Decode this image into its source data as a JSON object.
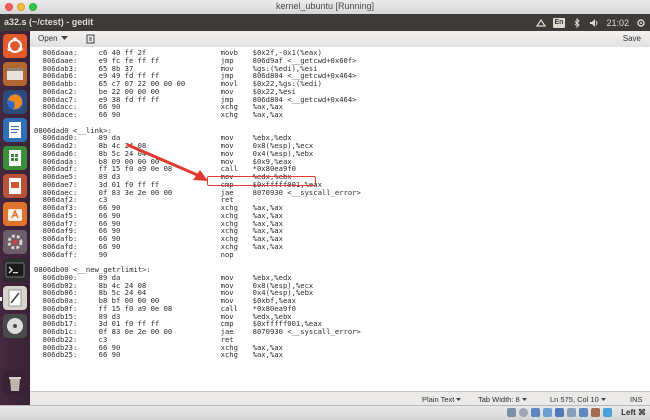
{
  "host": {
    "title": "kernel_ubuntu [Running]",
    "host_key": "Left ⌘"
  },
  "panel": {
    "window_title": "a32.s (~/ctest) - gedit",
    "keyboard": "En",
    "clock": "21:02"
  },
  "toolbar": {
    "open_label": "Open",
    "save_label": "Save"
  },
  "launcher": {
    "items": [
      "ubuntu-dash",
      "files",
      "firefox",
      "libreoffice-writer",
      "libreoffice-calc",
      "libreoffice-impress",
      "ubuntu-software",
      "system-settings",
      "terminal",
      "text-editor",
      "dvd",
      "trash"
    ]
  },
  "code_lines": [
    {
      "addr": "806daaa:",
      "hex": "c6 40 ff 2f",
      "op": "movb",
      "args": "$0x2f,-0x1(%eax)"
    },
    {
      "addr": "806daae:",
      "hex": "e9 fc fe ff ff",
      "op": "jmp",
      "args": "806d9af <__getcwd+0x60f>"
    },
    {
      "addr": "806dab3:",
      "hex": "65 8b 37",
      "op": "mov",
      "args": "%gs:(%edi),%esi"
    },
    {
      "addr": "806dab6:",
      "hex": "e9 49 fd ff ff",
      "op": "jmp",
      "args": "806d804 <__getcwd+0x464>"
    },
    {
      "addr": "806dabb:",
      "hex": "65 c7 07 22 00 00 00",
      "op": "movl",
      "args": "$0x22,%gs:(%edi)"
    },
    {
      "addr": "806dac2:",
      "hex": "be 22 00 00 00",
      "op": "mov",
      "args": "$0x22,%esi"
    },
    {
      "addr": "806dac7:",
      "hex": "e9 38 fd ff ff",
      "op": "jmp",
      "args": "806d804 <__getcwd+0x464>"
    },
    {
      "addr": "806dacc:",
      "hex": "66 90",
      "op": "xchg",
      "args": "%ax,%ax"
    },
    {
      "addr": "806dace:",
      "hex": "66 90",
      "op": "xchg",
      "args": "%ax,%ax"
    },
    {
      "label": ""
    },
    {
      "label": "0806dad0 <__link>:"
    },
    {
      "addr": "806dad0:",
      "hex": "89 da",
      "op": "mov",
      "args": "%ebx,%edx"
    },
    {
      "addr": "806dad2:",
      "hex": "8b 4c 24 08",
      "op": "mov",
      "args": "0x8(%esp),%ecx"
    },
    {
      "addr": "806dad6:",
      "hex": "8b 5c 24 04",
      "op": "mov",
      "args": "0x4(%esp),%ebx"
    },
    {
      "addr": "806dada:",
      "hex": "b8 09 00 00 00",
      "op": "mov",
      "args": "$0x9,%eax"
    },
    {
      "addr": "806dadf:",
      "hex": "ff 15 f0 a9 0e 08",
      "op": "call",
      "args": "*0x80ea9f0"
    },
    {
      "addr": "806dae5:",
      "hex": "89 d3",
      "op": "mov",
      "args": "%edx,%ebx"
    },
    {
      "addr": "806dae7:",
      "hex": "3d 01 f0 ff ff",
      "op": "cmp",
      "args": "$0xfffff001,%eax"
    },
    {
      "addr": "806daec:",
      "hex": "0f 83 3e 2e 00 00",
      "op": "jae",
      "args": "8070930 <__syscall_error>"
    },
    {
      "addr": "806daf2:",
      "hex": "c3",
      "op": "ret",
      "args": ""
    },
    {
      "addr": "806daf3:",
      "hex": "66 90",
      "op": "xchg",
      "args": "%ax,%ax"
    },
    {
      "addr": "806daf5:",
      "hex": "66 90",
      "op": "xchg",
      "args": "%ax,%ax"
    },
    {
      "addr": "806daf7:",
      "hex": "66 90",
      "op": "xchg",
      "args": "%ax,%ax"
    },
    {
      "addr": "806daf9:",
      "hex": "66 90",
      "op": "xchg",
      "args": "%ax,%ax"
    },
    {
      "addr": "806dafb:",
      "hex": "66 90",
      "op": "xchg",
      "args": "%ax,%ax"
    },
    {
      "addr": "806dafd:",
      "hex": "66 90",
      "op": "xchg",
      "args": "%ax,%ax"
    },
    {
      "addr": "806daff:",
      "hex": "90",
      "op": "nop",
      "args": ""
    },
    {
      "label": ""
    },
    {
      "label": "0806db00 <__new_getrlimit>:"
    },
    {
      "addr": "806db00:",
      "hex": "89 da",
      "op": "mov",
      "args": "%ebx,%edx"
    },
    {
      "addr": "806db02:",
      "hex": "8b 4c 24 08",
      "op": "mov",
      "args": "0x8(%esp),%ecx"
    },
    {
      "addr": "806db06:",
      "hex": "8b 5c 24 04",
      "op": "mov",
      "args": "0x4(%esp),%ebx"
    },
    {
      "addr": "806db0a:",
      "hex": "b8 bf 00 00 00",
      "op": "mov",
      "args": "$0xbf,%eax"
    },
    {
      "addr": "806db0f:",
      "hex": "ff 15 f0 a9 0e 08",
      "op": "call",
      "args": "*0x80ea9f0"
    },
    {
      "addr": "806db15:",
      "hex": "89 d3",
      "op": "mov",
      "args": "%edx,%ebx"
    },
    {
      "addr": "806db17:",
      "hex": "3d 01 f0 ff ff",
      "op": "cmp",
      "args": "$0xfffff001,%eax"
    },
    {
      "addr": "806db1c:",
      "hex": "0f 83 0e 2e 00 00",
      "op": "jae",
      "args": "8070930 <__syscall_error>"
    },
    {
      "addr": "806db22:",
      "hex": "c3",
      "op": "ret",
      "args": ""
    },
    {
      "addr": "806db23:",
      "hex": "66 90",
      "op": "xchg",
      "args": "%ax,%ax"
    },
    {
      "addr": "806db25:",
      "hex": "66 90",
      "op": "xchg",
      "args": "%ax,%ax"
    }
  ],
  "status": {
    "language": "Plain Text",
    "tab_width": "Tab Width: 8",
    "position": "Ln 575, Col 10",
    "mode": "INS"
  },
  "colors": {
    "annotation": "#e03a2e",
    "panel": "#3c3b37",
    "launcher": "#3a2236"
  }
}
